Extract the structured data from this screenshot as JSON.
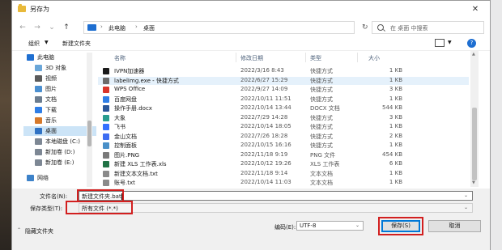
{
  "window": {
    "title": "另存为",
    "close_glyph": "✕"
  },
  "nav": {
    "back_glyph": "←",
    "forward_glyph": "→",
    "dropdown_glyph": "⌄",
    "up_glyph": "↑",
    "breadcrumb": [
      "此电脑",
      "桌面"
    ],
    "breadcrumb_sep": "›",
    "search_placeholder": "在 桌面 中搜索"
  },
  "toolbar": {
    "organize_label": "组织",
    "new_folder_label": "新建文件夹",
    "help_glyph": "?"
  },
  "sidebar": {
    "items": [
      {
        "label": "此电脑",
        "icon": "pc-icon"
      },
      {
        "label": "3D 对象",
        "icon": "3d-objects-icon"
      },
      {
        "label": "视频",
        "icon": "video-icon"
      },
      {
        "label": "图片",
        "icon": "pictures-icon"
      },
      {
        "label": "文档",
        "icon": "documents-icon"
      },
      {
        "label": "下载",
        "icon": "downloads-icon"
      },
      {
        "label": "音乐",
        "icon": "music-icon"
      },
      {
        "label": "桌面",
        "icon": "desktop-icon"
      },
      {
        "label": "本地磁盘 (C:)",
        "icon": "drive-icon"
      },
      {
        "label": "新加卷 (D:)",
        "icon": "drive-icon"
      },
      {
        "label": "新加卷 (E:)",
        "icon": "drive-icon"
      },
      {
        "label": "网络",
        "icon": "network-icon"
      }
    ],
    "selected_index": 7
  },
  "columns": {
    "name": "名称",
    "date": "修改日期",
    "type": "类型",
    "size": "大小"
  },
  "files": [
    {
      "name": "IVPN加速器",
      "date": "2022/3/16 8:43",
      "type": "快捷方式",
      "size": "1 KB",
      "icon_color": "#1a1a1a"
    },
    {
      "name": "labelImg.exe - 快捷方式",
      "date": "2022/6/27 15:29",
      "type": "快捷方式",
      "size": "1 KB",
      "icon_color": "#6b6b6b"
    },
    {
      "name": "WPS Office",
      "date": "2022/9/27 14:09",
      "type": "快捷方式",
      "size": "3 KB",
      "icon_color": "#d9352b"
    },
    {
      "name": "百度网盘",
      "date": "2022/10/11 11:51",
      "type": "快捷方式",
      "size": "1 KB",
      "icon_color": "#2f7ee6"
    },
    {
      "name": "操作手册.docx",
      "date": "2022/10/14 13:44",
      "type": "DOCX 文档",
      "size": "544 KB",
      "icon_color": "#2b579a"
    },
    {
      "name": "大象",
      "date": "2022/7/29 14:28",
      "type": "快捷方式",
      "size": "3 KB",
      "icon_color": "#2a9d8f"
    },
    {
      "name": "飞书",
      "date": "2022/10/14 18:05",
      "type": "快捷方式",
      "size": "1 KB",
      "icon_color": "#3370ff"
    },
    {
      "name": "金山文档",
      "date": "2022/7/26 18:28",
      "type": "快捷方式",
      "size": "2 KB",
      "icon_color": "#3d6df2"
    },
    {
      "name": "控制面板",
      "date": "2022/10/15 16:16",
      "type": "快捷方式",
      "size": "1 KB",
      "icon_color": "#4a90c8"
    },
    {
      "name": "图片.PNG",
      "date": "2022/11/18 9:19",
      "type": "PNG 文件",
      "size": "454 KB",
      "icon_color": "#7a7a7a"
    },
    {
      "name": "新建 XLS 工作表.xls",
      "date": "2022/10/12 19:26",
      "type": "XLS 工作表",
      "size": "6 KB",
      "icon_color": "#217346"
    },
    {
      "name": "新建文本文档.txt",
      "date": "2022/11/18 9:14",
      "type": "文本文档",
      "size": "1 KB",
      "icon_color": "#8a8a8a"
    },
    {
      "name": "账号.txt",
      "date": "2022/10/14 11:03",
      "type": "文本文档",
      "size": "1 KB",
      "icon_color": "#8a8a8a"
    }
  ],
  "selected_file_index": 1,
  "form": {
    "filename_label": "文件名(N):",
    "filename_value": "新建文件夹.bat",
    "filetype_label": "保存类型(T):",
    "filetype_value": "所有文件 (*.*)",
    "encoding_label": "编码(E):",
    "encoding_value": "UTF-8",
    "save_label": "保存(S)",
    "cancel_label": "取消",
    "hide_folders_label": "隐藏文件夹",
    "hide_folders_glyph": "⌃"
  },
  "colors": {
    "highlight": "#d21f1f",
    "selection": "#cce4f7",
    "accent": "#0078d7"
  }
}
